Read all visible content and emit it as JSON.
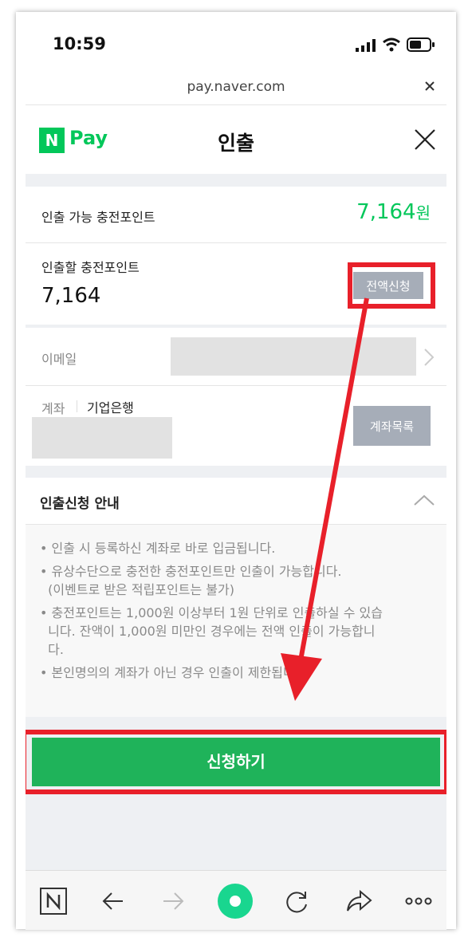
{
  "status": {
    "time": "10:59"
  },
  "browser": {
    "url": "pay.naver.com"
  },
  "header": {
    "logo_n": "N",
    "logo_pay": "Pay",
    "title": "인출"
  },
  "available": {
    "label": "인출 가능 충전포인트",
    "amount": "7,164",
    "unit": "원"
  },
  "withdraw": {
    "label": "인출할 충전포인트",
    "value": "7,164",
    "full_button": "전액신청"
  },
  "email": {
    "label": "이메일"
  },
  "account": {
    "label": "계좌",
    "bank": "기업은행",
    "list_button": "계좌목록"
  },
  "guide": {
    "title": "인출신청 안내",
    "lines": [
      "• 인출 시 등록하신 계좌로 바로 입금됩니다.",
      "• 유상수단으로 충전한 충전포인트만 인출이 가능합니다.",
      "  (이벤트로 받은 적립포인트는 불가)",
      "• 충전포인트는 1,000원 이상부터 1원 단위로 인출하실 수 있습",
      "  니다. 잔액이 1,000원 미만인 경우에는 전액 인출이 가능합니",
      "  다.",
      "• 본인명의의 계좌가 아닌 경우 인출이 제한됩니다."
    ]
  },
  "submit": {
    "label": "신청하기"
  },
  "colors": {
    "brand": "#03c75a",
    "highlight": "#e8202a",
    "button_gray": "#a6adb8"
  }
}
